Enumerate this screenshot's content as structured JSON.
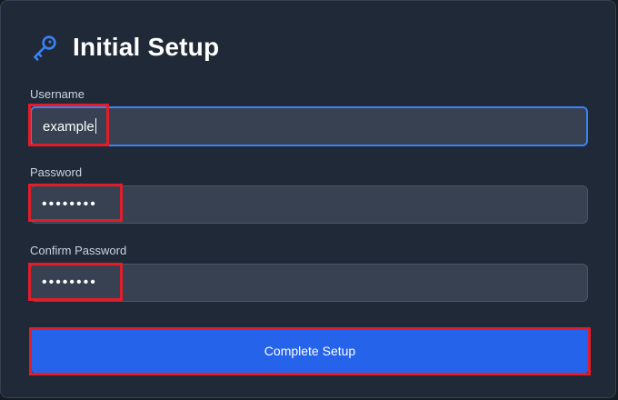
{
  "form": {
    "title": "Initial Setup",
    "icon": "key-icon",
    "accent_color": "#3b82f6",
    "fields": [
      {
        "label": "Username",
        "value": "example",
        "state": "focused"
      },
      {
        "label": "Password",
        "value": "••••••••",
        "masked": true
      },
      {
        "label": "Confirm Password",
        "value": "••••••••",
        "masked": true
      }
    ],
    "submit_label": "Complete Setup",
    "highlight_color": "#e11d2a"
  }
}
